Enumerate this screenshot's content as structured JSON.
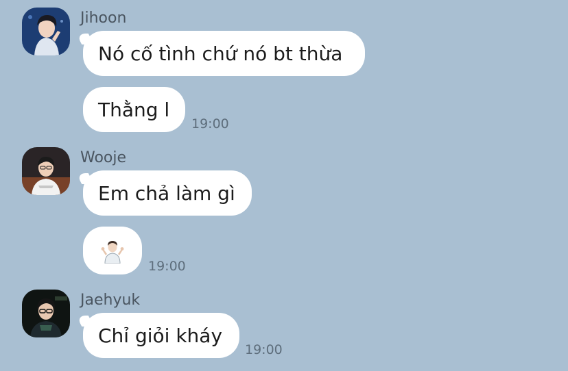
{
  "messages": [
    {
      "sender": "Jihoon",
      "avatar_icon": "avatar-jihoon",
      "bubbles": [
        {
          "text": "Nó cố tình chứ nó bt thừa",
          "time": ""
        },
        {
          "text": "Thằng l",
          "time": "19:00"
        }
      ]
    },
    {
      "sender": "Wooje",
      "avatar_icon": "avatar-wooje",
      "bubbles": [
        {
          "text": "Em chả làm gì",
          "time": ""
        },
        {
          "text": "",
          "emoji": "person-shrugging-emoji",
          "time": "19:00"
        }
      ]
    },
    {
      "sender": "Jaehyuk",
      "avatar_icon": "avatar-jaehyuk",
      "bubbles": [
        {
          "text": "Chỉ giỏi kháy",
          "time": "19:00"
        }
      ]
    }
  ],
  "colors": {
    "background": "#a9bfd2",
    "bubble": "#ffffff",
    "name_text": "#4a5560",
    "time_text": "#5e6e7c"
  }
}
